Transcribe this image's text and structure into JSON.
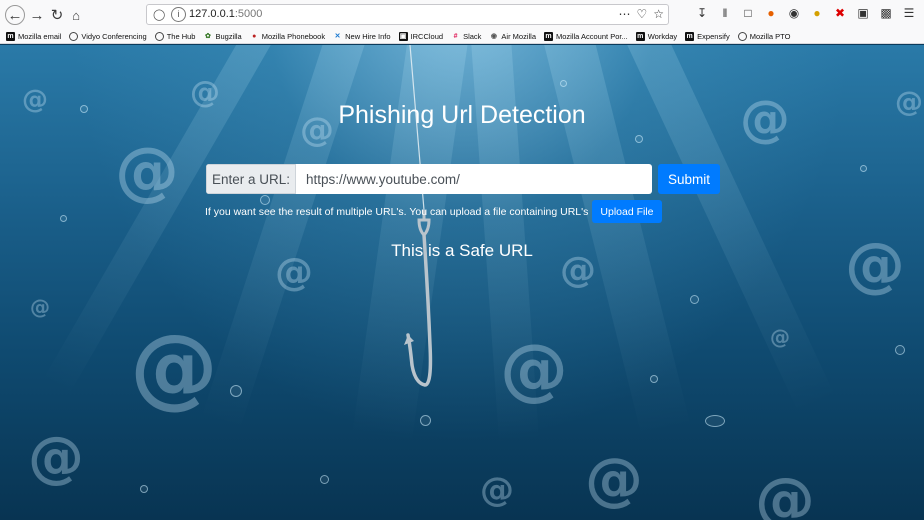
{
  "browser": {
    "url_host": "127.0.0.1",
    "url_port": ":5000",
    "bookmarks": [
      {
        "label": "Mozilla email",
        "icon": "m"
      },
      {
        "label": "Vidyo Conferencing",
        "icon": "globe"
      },
      {
        "label": "The Hub",
        "icon": "globe"
      },
      {
        "label": "Bugzilla",
        "icon": "bug"
      },
      {
        "label": "Mozilla Phonebook",
        "icon": "phonebook"
      },
      {
        "label": "New Hire Info",
        "icon": "x"
      },
      {
        "label": "IRCCloud",
        "icon": "cloud"
      },
      {
        "label": "Slack",
        "icon": "slack"
      },
      {
        "label": "Air Mozilla",
        "icon": "air"
      },
      {
        "label": "Mozilla Account Por...",
        "icon": "m"
      },
      {
        "label": "Workday",
        "icon": "m"
      },
      {
        "label": "Expensify",
        "icon": "m"
      },
      {
        "label": "Mozilla PTO",
        "icon": "globe"
      }
    ]
  },
  "page": {
    "title": "Phishing Url Detection",
    "url_label": "Enter a URL:",
    "url_value": "https://www.youtube.com/",
    "submit_label": "Submit",
    "upload_text": "If you want see the result of multiple URL's. You can upload a file containing URL's",
    "upload_button": "Upload File",
    "result": "This is a Safe URL"
  },
  "colors": {
    "primary_button": "#007bff",
    "water_top": "#2a7aa8",
    "water_bottom": "#083452"
  }
}
